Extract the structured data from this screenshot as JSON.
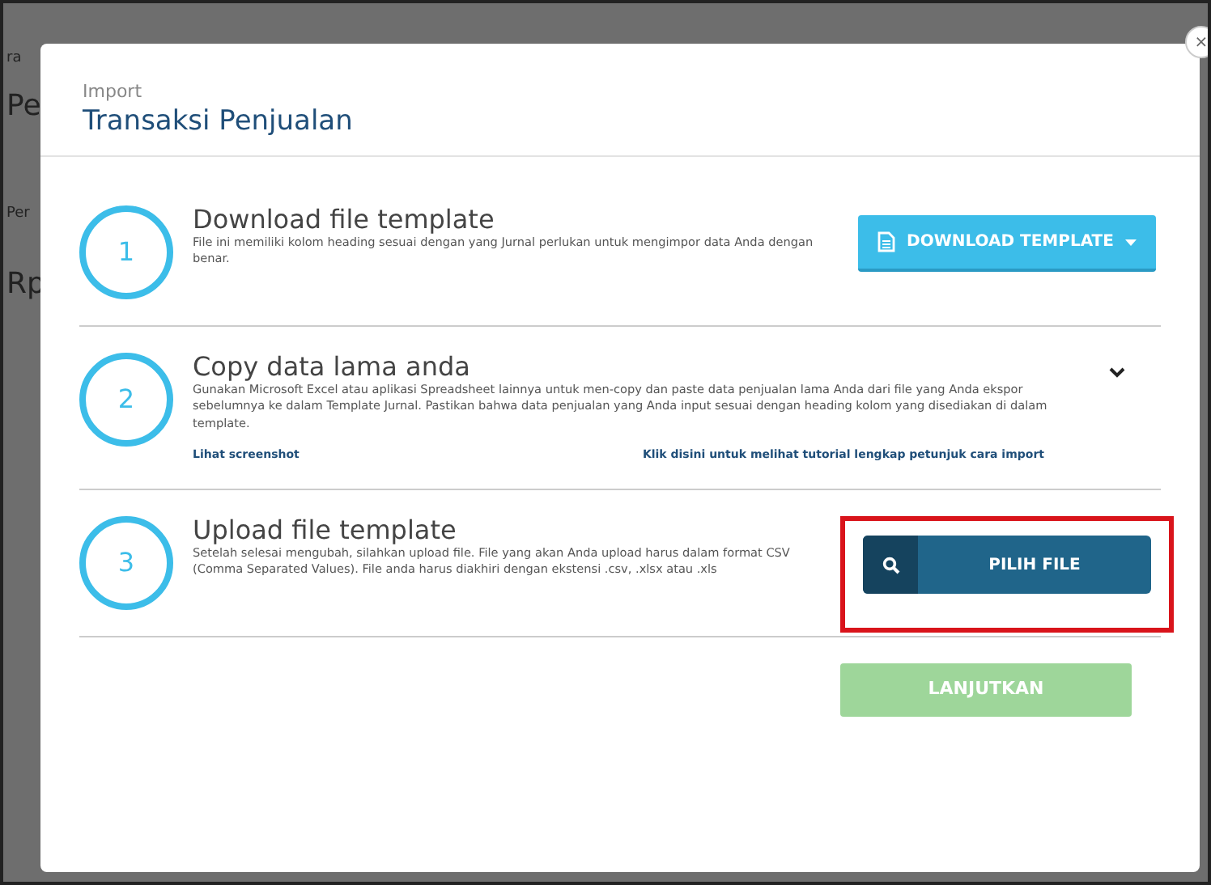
{
  "background": {
    "fragments": [
      "ra",
      "Pe",
      "Per",
      "Rp"
    ]
  },
  "modal": {
    "subtitle": "Import",
    "title": "Transaksi Penjualan",
    "close": "×"
  },
  "steps": [
    {
      "number": "1",
      "title": "Download file template",
      "description": "File ini memiliki kolom heading sesuai dengan yang Jurnal perlukan untuk mengimpor data Anda dengan benar.",
      "action": {
        "kind": "download",
        "label": "DOWNLOAD TEMPLATE"
      }
    },
    {
      "number": "2",
      "title": "Copy data lama anda",
      "description": "Gunakan Microsoft Excel atau aplikasi Spreadsheet lainnya untuk men-copy dan paste data penjualan lama Anda dari file yang Anda ekspor sebelumnya ke dalam Template Jurnal. Pastikan bahwa data penjualan yang Anda input sesuai dengan heading kolom yang disediakan di dalam template.",
      "links": [
        "Lihat screenshot",
        "Klik disini untuk melihat tutorial lengkap petunjuk cara import"
      ],
      "action": {
        "kind": "expand",
        "expanded": false
      }
    },
    {
      "number": "3",
      "title": "Upload file template",
      "description": "Setelah selesai mengubah, silahkan upload file. File yang akan Anda upload harus dalam format CSV (Comma Separated Values). File anda harus diakhiri dengan ekstensi .csv, .xlsx atau .xls",
      "action": {
        "kind": "upload",
        "label": "PILIH FILE",
        "highlighted": true
      }
    }
  ],
  "continue_button": {
    "label": "LANJUTKAN",
    "disabled": true
  }
}
